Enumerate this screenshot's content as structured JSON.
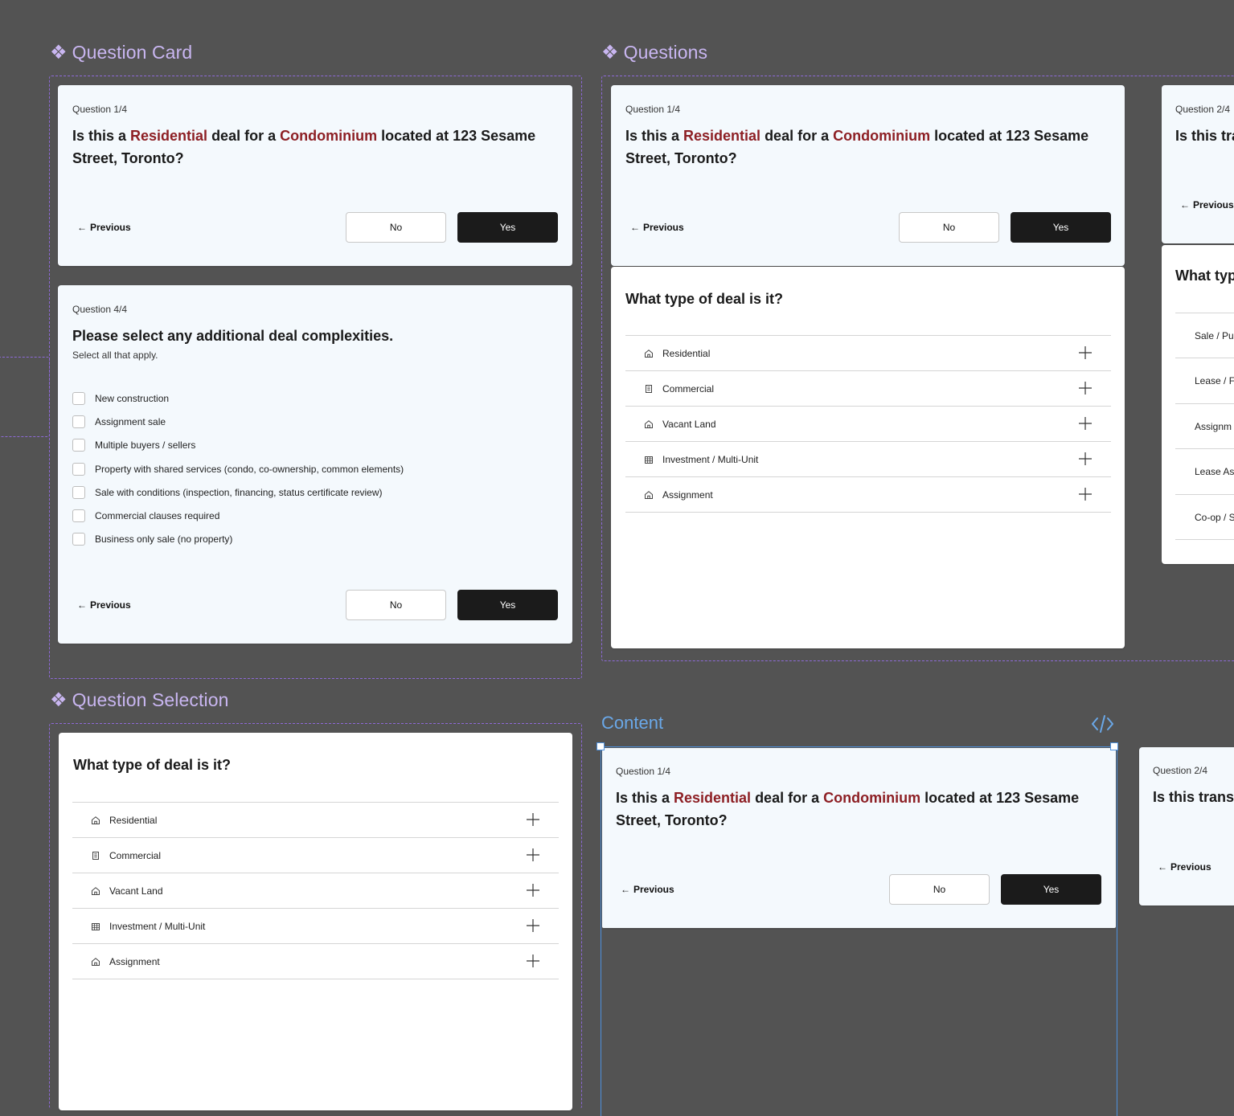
{
  "sections": {
    "question_card": "Question Card",
    "questions": "Questions",
    "question_selection": "Question Selection",
    "content": "Content"
  },
  "card1": {
    "label": "Question 1/4",
    "q_pre": "Is this a ",
    "q_h1": "Residential",
    "q_mid": " deal for a ",
    "q_h2": "Condominium",
    "q_post": " located at 123 Sesame Street, Toronto?",
    "previous": "Previous",
    "no": "No",
    "yes": "Yes"
  },
  "card4": {
    "label": "Question 4/4",
    "question": "Please select any additional deal complexities.",
    "subtitle": "Select all that apply.",
    "options": [
      "New construction",
      "Assignment sale",
      "Multiple buyers / sellers",
      "Property with shared services (condo, co-ownership, common elements)",
      "Sale with conditions (inspection, financing, status certificate review)",
      "Commercial clauses required",
      "Business only sale (no property)"
    ],
    "previous": "Previous",
    "no": "No",
    "yes": "Yes"
  },
  "deal_type": {
    "question": "What type of deal is it?",
    "items": [
      "Residential",
      "Commercial",
      "Vacant Land",
      "Investment / Multi-Unit",
      "Assignment"
    ]
  },
  "card2_partial": {
    "label": "Question 2/4",
    "q_fragment_top": "Is this tra",
    "q_fragment_bottom": "Is this trans",
    "previous": "Previous",
    "what_fragment": "What typ",
    "items": [
      "Sale / Pu",
      "Lease / F",
      "Assignm",
      "Lease As",
      "Co-op / S"
    ]
  }
}
